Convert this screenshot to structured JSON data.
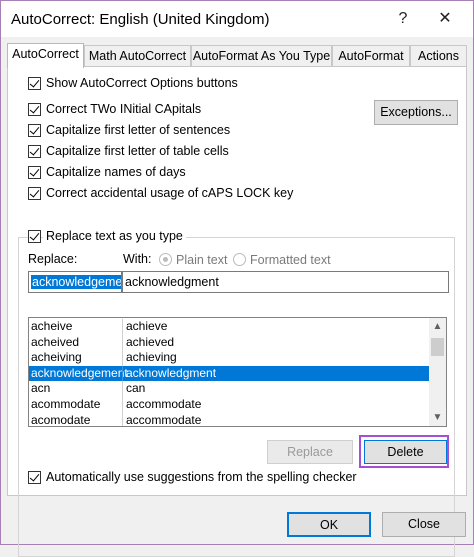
{
  "window": {
    "title": "AutoCorrect: English (United Kingdom)",
    "help_glyph": "?",
    "close_glyph": "✕"
  },
  "tabs": [
    {
      "label": "AutoCorrect",
      "active": true
    },
    {
      "label": "Math AutoCorrect"
    },
    {
      "label": "AutoFormat As You Type"
    },
    {
      "label": "AutoFormat"
    },
    {
      "label": "Actions"
    }
  ],
  "options": {
    "show_buttons": "Show AutoCorrect Options buttons",
    "two_initial": "Correct TWo INitial CApitals",
    "first_letter_sentences": "Capitalize first letter of sentences",
    "first_letter_table": "Capitalize first letter of table cells",
    "names_of_days": "Capitalize names of days",
    "caps_lock": "Correct accidental usage of cAPS LOCK key",
    "exceptions_button": "Exceptions..."
  },
  "replace_section": {
    "replace_as_you_type": "Replace text as you type",
    "replace_label": "Replace:",
    "with_label": "With:",
    "plain_text": "Plain text",
    "formatted_text": "Formatted text",
    "replace_value": "acknowledgement",
    "with_value": "acknowledgment"
  },
  "entries": [
    {
      "replace": "acheive",
      "with": "achieve"
    },
    {
      "replace": "acheived",
      "with": "achieved"
    },
    {
      "replace": "acheiving",
      "with": "achieving"
    },
    {
      "replace": "acknowledgement",
      "with": "acknowledgment",
      "selected": true
    },
    {
      "replace": "acn",
      "with": "can"
    },
    {
      "replace": "acommodate",
      "with": "accommodate"
    },
    {
      "replace": "acomodate",
      "with": "accommodate"
    }
  ],
  "list_buttons": {
    "replace": "Replace",
    "delete": "Delete"
  },
  "spelling_suggestions": "Automatically use suggestions from the spelling checker",
  "footer": {
    "ok": "OK",
    "close": "Close"
  },
  "colors": {
    "selection": "#0078d7",
    "highlight_box": "#a64fd6"
  }
}
